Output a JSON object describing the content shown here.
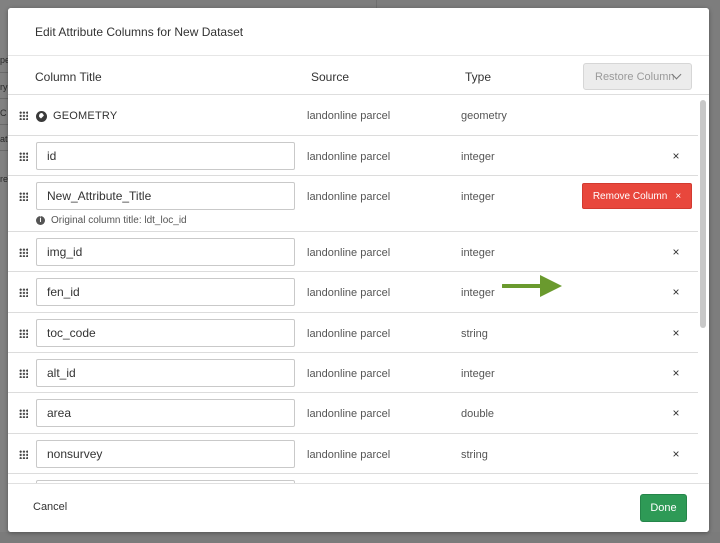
{
  "background": {
    "fragments": [
      "pe",
      "ry",
      "C",
      "at",
      "re"
    ]
  },
  "modal": {
    "title": "Edit Attribute Columns for New Dataset",
    "headers": {
      "title": "Column Title",
      "source": "Source",
      "type": "Type"
    },
    "restore_label": "Restore Column",
    "geometry_row": {
      "title": "GEOMETRY",
      "source": "landonline parcel",
      "type": "geometry",
      "icon": "globe-icon"
    },
    "rows": [
      {
        "title": "id",
        "source": "landonline parcel",
        "type": "integer"
      },
      {
        "title": "New_Attribute_Title",
        "source": "landonline parcel",
        "type": "integer",
        "note": "Original column title: ldt_loc_id"
      },
      {
        "title": "img_id",
        "source": "landonline parcel",
        "type": "integer"
      },
      {
        "title": "fen_id",
        "source": "landonline parcel",
        "type": "integer"
      },
      {
        "title": "toc_code",
        "source": "landonline parcel",
        "type": "string"
      },
      {
        "title": "alt_id",
        "source": "landonline parcel",
        "type": "integer"
      },
      {
        "title": "area",
        "source": "landonline parcel",
        "type": "double"
      },
      {
        "title": "nonsurvey",
        "source": "landonline parcel",
        "type": "string"
      },
      {
        "title": "",
        "source": "",
        "type": ""
      }
    ],
    "remove_label": "Remove Column",
    "close_glyph": "×",
    "cancel_label": "Cancel",
    "done_label": "Done"
  },
  "colors": {
    "remove": "#e8473c",
    "done": "#2e9a56",
    "arrow": "#6a9a2e"
  }
}
